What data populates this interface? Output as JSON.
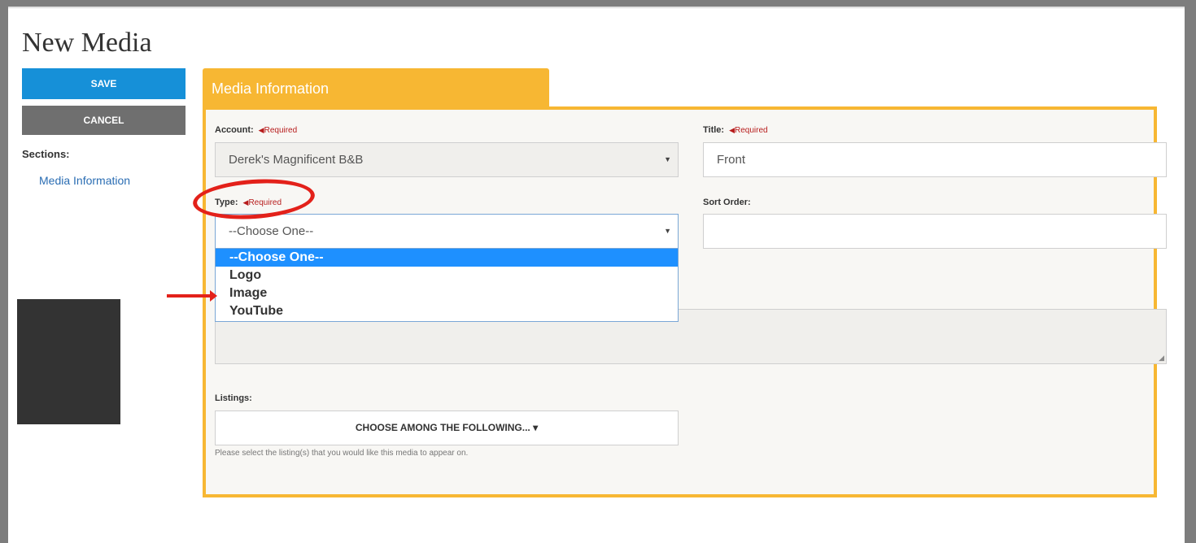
{
  "page": {
    "title": "New Media"
  },
  "actions": {
    "save_label": "SAVE",
    "cancel_label": "CANCEL"
  },
  "sidebar": {
    "sections_label": "Sections:",
    "links": [
      "Media Information"
    ]
  },
  "tab": {
    "label": "Media Information"
  },
  "form": {
    "required_text": "Required",
    "account": {
      "label": "Account:",
      "value": "Derek's Magnificent B&B"
    },
    "title": {
      "label": "Title:",
      "value": "Front"
    },
    "type": {
      "label": "Type:",
      "value": "--Choose One--",
      "options": [
        "--Choose One--",
        "Logo",
        "Image",
        "YouTube"
      ],
      "selected_index": 0
    },
    "sort_order": {
      "label": "Sort Order:",
      "value": ""
    },
    "listings": {
      "label": "Listings:",
      "button_label": "CHOOSE AMONG THE FOLLOWING...",
      "help": "Please select the listing(s) that you would like this media to appear on."
    }
  },
  "colors": {
    "accent": "#f7b733",
    "primary": "#1690d8",
    "annotation": "#e3211a"
  }
}
